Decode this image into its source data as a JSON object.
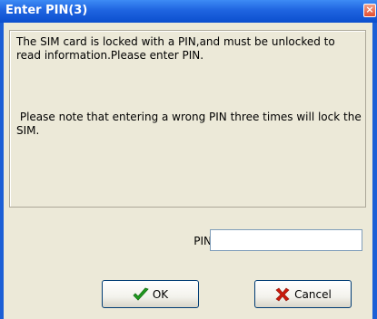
{
  "window": {
    "title": "Enter PIN(3)",
    "close_glyph": "×"
  },
  "message": {
    "line1": "The SIM card is locked with a PIN,and must be unlocked to read information.Please enter PIN.",
    "line2": " Please note that entering a wrong PIN three times will lock the SIM."
  },
  "pin": {
    "label": "PIN",
    "value": ""
  },
  "buttons": {
    "ok_label": "OK",
    "ok_icon": "checkmark-icon",
    "cancel_label": "Cancel",
    "cancel_icon": "x-mark-icon"
  },
  "colors": {
    "title_bar": "#1f64e0",
    "dialog_bg": "#ece9d8",
    "ok_icon": "#1f9a1f",
    "cancel_icon": "#cc1a0c"
  }
}
